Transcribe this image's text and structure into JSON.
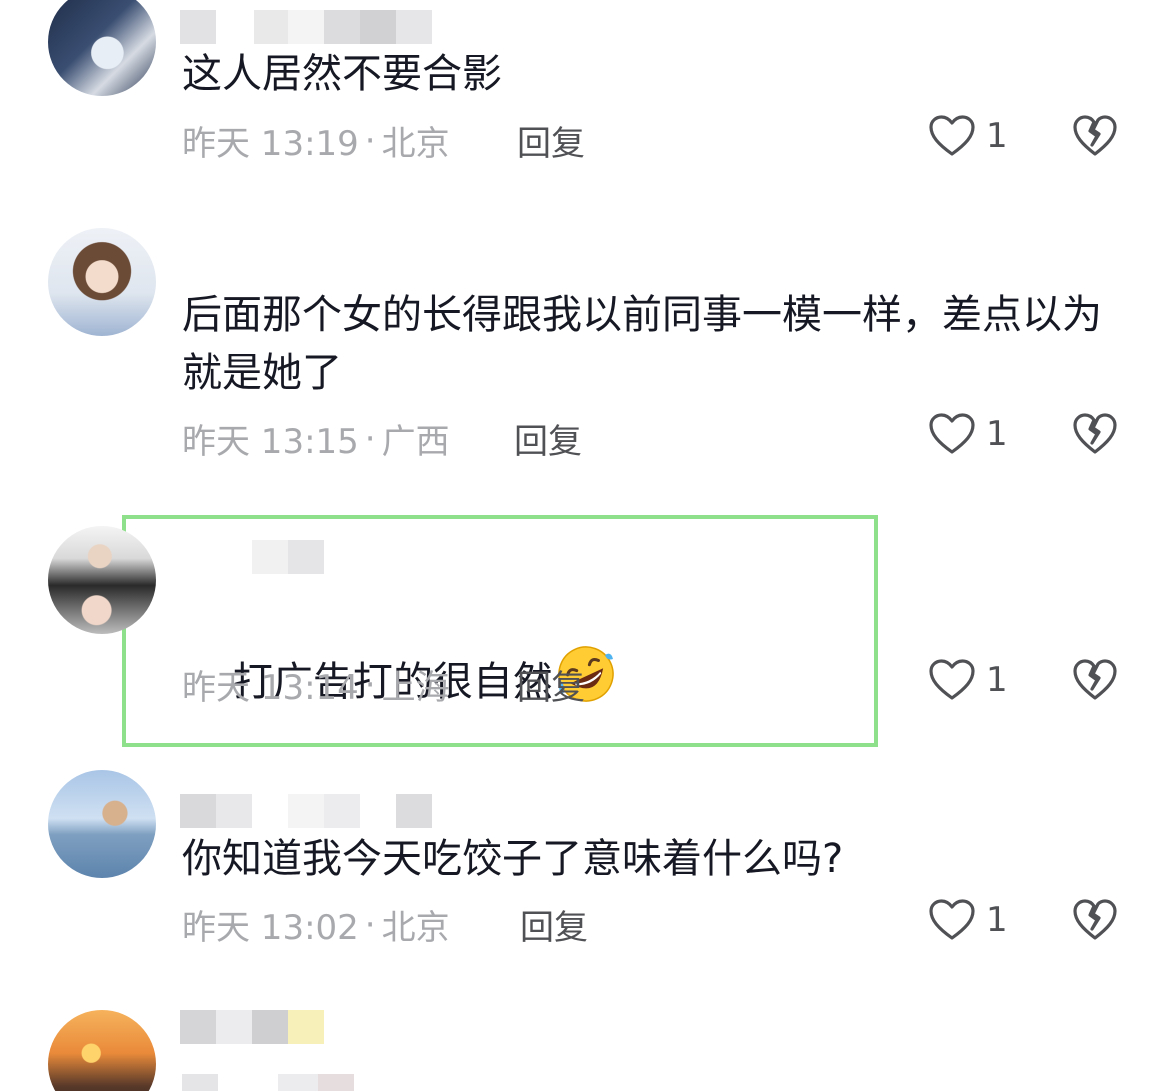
{
  "comments": [
    {
      "text": "这人居然不要合影",
      "time": "昨天 13:19",
      "sep": "·",
      "location": "北京",
      "reply": "回复",
      "likes": "1",
      "avatar_icon": "motorcycle-avatar"
    },
    {
      "text": "后面那个女的长得跟我以前同事一模一样，差点以为就是她了",
      "time": "昨天 13:15",
      "sep": "·",
      "location": "广西",
      "reply": "回复",
      "likes": "1",
      "avatar_icon": "girl-avatar"
    },
    {
      "text": "打广告打的很自然",
      "emoji": "rolling-on-floor-laughing-emoji",
      "time": "昨天 13:14",
      "sep": "·",
      "location": "上海",
      "reply": "回复",
      "likes": "1",
      "avatar_icon": "couple-avatar"
    },
    {
      "text": "你知道我今天吃饺子了意味着什么吗?",
      "time": "昨天 13:02",
      "sep": "·",
      "location": "北京",
      "reply": "回复",
      "likes": "1",
      "avatar_icon": "man-seaside-avatar"
    }
  ],
  "colors": {
    "text": "#161823",
    "meta": "#a8a9ad",
    "action": "#505155",
    "highlight": "#8ee08a"
  }
}
